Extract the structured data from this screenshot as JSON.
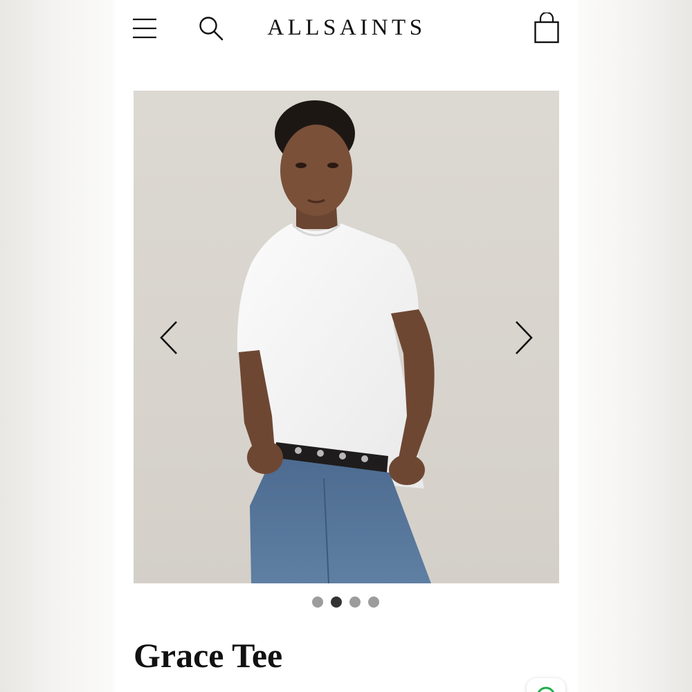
{
  "header": {
    "brand": "ALLSAINTS",
    "icons": {
      "menu": "hamburger-menu-icon",
      "search": "search-icon",
      "bag": "shopping-bag-icon"
    }
  },
  "carousel": {
    "slide_count": 4,
    "active_index": 1,
    "icons": {
      "previous": "chevron-left-icon",
      "next": "chevron-right-icon"
    }
  },
  "product": {
    "name": "Grace Tee"
  },
  "chat": {
    "icon": "chat-bubble-icon",
    "accent": "#1fae4b"
  },
  "colors": {
    "text": "#111111",
    "dot_active": "#333333",
    "dot_inactive": "#9c9c9c",
    "photo_background": "#d9d5ce"
  }
}
